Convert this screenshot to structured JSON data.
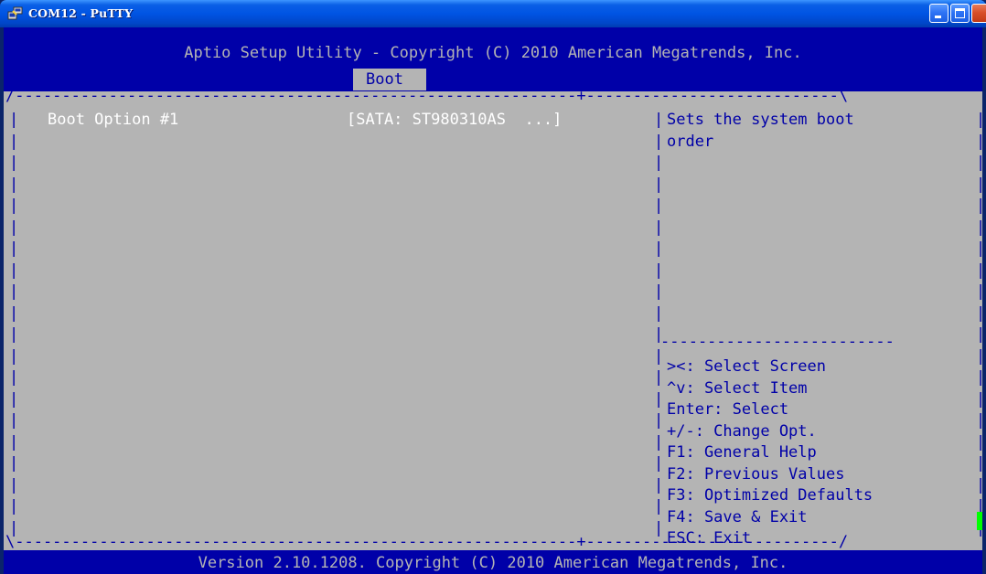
{
  "window": {
    "title": "COM12 - PuTTY",
    "icon": "putty-icon"
  },
  "bios": {
    "header": "Aptio Setup Utility - Copyright (C) 2010 American Megatrends, Inc.",
    "active_tab": "Boot",
    "options": [
      {
        "label": "Boot Option #1",
        "value": "[SATA: ST980310AS  ...]"
      }
    ],
    "help": {
      "line1": "Sets the system boot",
      "line2": "order"
    },
    "keys": [
      "><: Select Screen",
      "^v: Select Item",
      "Enter: Select",
      "+/-: Change Opt.",
      "F1: General Help",
      "F2: Previous Values",
      "F3: Optimized Defaults",
      "F4: Save & Exit",
      "ESC: Exit"
    ],
    "footer": "Version 2.10.1208. Copyright (C) 2010 American Megatrends, Inc."
  },
  "colors": {
    "terminal_bg": "#0000a8",
    "panel_bg": "#b4b4b4",
    "panel_text": "#0000a8",
    "highlight_text": "#ffffff",
    "cursor": "#00ff00"
  }
}
